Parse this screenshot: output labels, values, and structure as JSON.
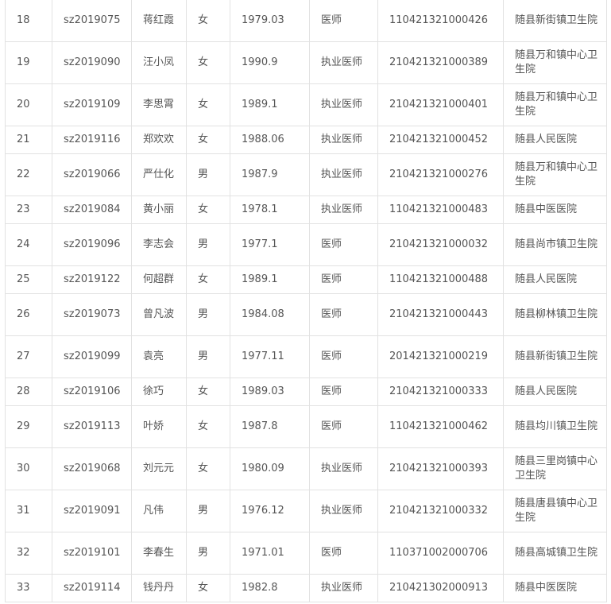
{
  "table": {
    "rows": [
      {
        "no": "18",
        "id": "sz2019075",
        "name": "蒋红霞",
        "gender": "女",
        "birth": "1979.03",
        "title": "医师",
        "cert": "110421321000426",
        "unit": "随县新街镇卫生院"
      },
      {
        "no": "19",
        "id": "sz2019090",
        "name": "汪小凤",
        "gender": "女",
        "birth": "1990.9",
        "title": "执业医师",
        "cert": "210421321000389",
        "unit": "随县万和镇中心卫生院"
      },
      {
        "no": "20",
        "id": "sz2019109",
        "name": "李思霄",
        "gender": "女",
        "birth": "1989.1",
        "title": "执业医师",
        "cert": "210421321000401",
        "unit": "随县万和镇中心卫生院"
      },
      {
        "no": "21",
        "id": "sz2019116",
        "name": "郑欢欢",
        "gender": "女",
        "birth": "1988.06",
        "title": "执业医师",
        "cert": "210421321000452",
        "unit": "随县人民医院"
      },
      {
        "no": "22",
        "id": "sz2019066",
        "name": "严仕化",
        "gender": "男",
        "birth": "1987.9",
        "title": "执业医师",
        "cert": "210421321000276",
        "unit": "随县万和镇中心卫生院"
      },
      {
        "no": "23",
        "id": "sz2019084",
        "name": "黄小丽",
        "gender": "女",
        "birth": "1978.1",
        "title": "执业医师",
        "cert": "110421321000483",
        "unit": "随县中医医院"
      },
      {
        "no": "24",
        "id": "sz2019096",
        "name": "李志会",
        "gender": "男",
        "birth": "1977.1",
        "title": "医师",
        "cert": "210421321000032",
        "unit": "随县尚市镇卫生院"
      },
      {
        "no": "25",
        "id": "sz2019122",
        "name": "何超群",
        "gender": "女",
        "birth": "1989.1",
        "title": "医师",
        "cert": "110421321000488",
        "unit": "随县人民医院"
      },
      {
        "no": "26",
        "id": "sz2019073",
        "name": "曾凡波",
        "gender": "男",
        "birth": "1984.08",
        "title": "医师",
        "cert": "210421321000443",
        "unit": "随县柳林镇卫生院"
      },
      {
        "no": "27",
        "id": "sz2019099",
        "name": "袁亮",
        "gender": "男",
        "birth": "1977.11",
        "title": "医师",
        "cert": "201421321000219",
        "unit": "随县新街镇卫生院"
      },
      {
        "no": "28",
        "id": "sz2019106",
        "name": "徐巧",
        "gender": "女",
        "birth": "1989.03",
        "title": "医师",
        "cert": "210421321000333",
        "unit": "随县人民医院"
      },
      {
        "no": "29",
        "id": "sz2019113",
        "name": "叶娇",
        "gender": "女",
        "birth": "1987.8",
        "title": "医师",
        "cert": "110421321000462",
        "unit": "随县均川镇卫生院"
      },
      {
        "no": "30",
        "id": "sz2019068",
        "name": "刘元元",
        "gender": "女",
        "birth": "1980.09",
        "title": "执业医师",
        "cert": "210421321000393",
        "unit": "随县三里岗镇中心卫生院"
      },
      {
        "no": "31",
        "id": "sz2019091",
        "name": "凡伟",
        "gender": "男",
        "birth": "1976.12",
        "title": "执业医师",
        "cert": "210421321000332",
        "unit": "随县唐县镇中心卫生院"
      },
      {
        "no": "32",
        "id": "sz2019101",
        "name": "李春生",
        "gender": "男",
        "birth": "1971.01",
        "title": "医师",
        "cert": "110371002000706",
        "unit": "随县高城镇卫生院"
      },
      {
        "no": "33",
        "id": "sz2019114",
        "name": "钱丹丹",
        "gender": "女",
        "birth": "1982.8",
        "title": "执业医师",
        "cert": "210421302000913",
        "unit": "随县中医医院"
      }
    ]
  },
  "colors": {
    "text": "#555555",
    "border": "#e2e2e2",
    "background": "#ffffff"
  }
}
